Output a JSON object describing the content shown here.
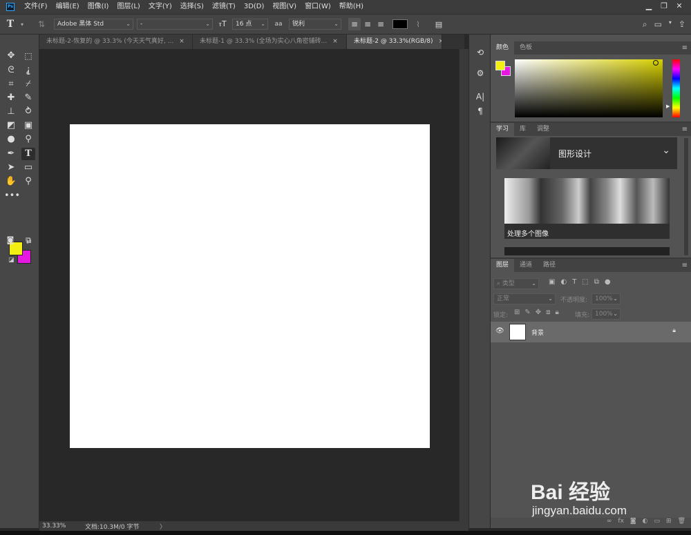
{
  "menubar": {
    "logo": "Ps",
    "items": [
      "文件(F)",
      "编辑(E)",
      "图像(I)",
      "图层(L)",
      "文字(Y)",
      "选择(S)",
      "滤镜(T)",
      "3D(D)",
      "视图(V)",
      "窗口(W)",
      "帮助(H)"
    ],
    "win": [
      "▁",
      "❐",
      "✕"
    ]
  },
  "options": {
    "tool_glyph": "T",
    "font_family": "Adobe 黑体 Std",
    "font_style": "-",
    "font_size": "16 点",
    "aa_label": "aa",
    "aa_value": "锐利",
    "color": "#000000"
  },
  "tabs": [
    {
      "label": "未标题-2-恢复的 @ 33.3% (今天天气真好, ..."
    },
    {
      "label": "未标题-1 @ 33.3% (全场为实心八角密铺砖..."
    },
    {
      "label": "未标题-2 @ 33.3%(RGB/8)"
    }
  ],
  "tab_close": "×",
  "colors": {
    "foreground": "#f4ef12",
    "background": "#e617e0",
    "accent": "#31a8ff"
  },
  "status": {
    "zoom": "33.33%",
    "doc": "文档:10.3M/0 字节",
    "arrow": "〉"
  },
  "panel_color": {
    "tabs": [
      "颜色",
      "色板"
    ]
  },
  "panel_learn": {
    "tabs": [
      "学习",
      "库",
      "调整"
    ],
    "heading": "图形设计",
    "card_title": "处理多个图像"
  },
  "panel_layers": {
    "tabs": [
      "图层",
      "通道",
      "路径"
    ],
    "filter_placeholder": "类型",
    "blend_mode": "正常",
    "opacity_label": "不透明度:",
    "opacity_value": "100%",
    "lock_label": "锁定:",
    "fill_label": "填充:",
    "fill_value": "100%",
    "layer_name": "背景"
  },
  "watermark": {
    "line1": "Bai 经验",
    "line2": "jingyan.baidu.com"
  }
}
